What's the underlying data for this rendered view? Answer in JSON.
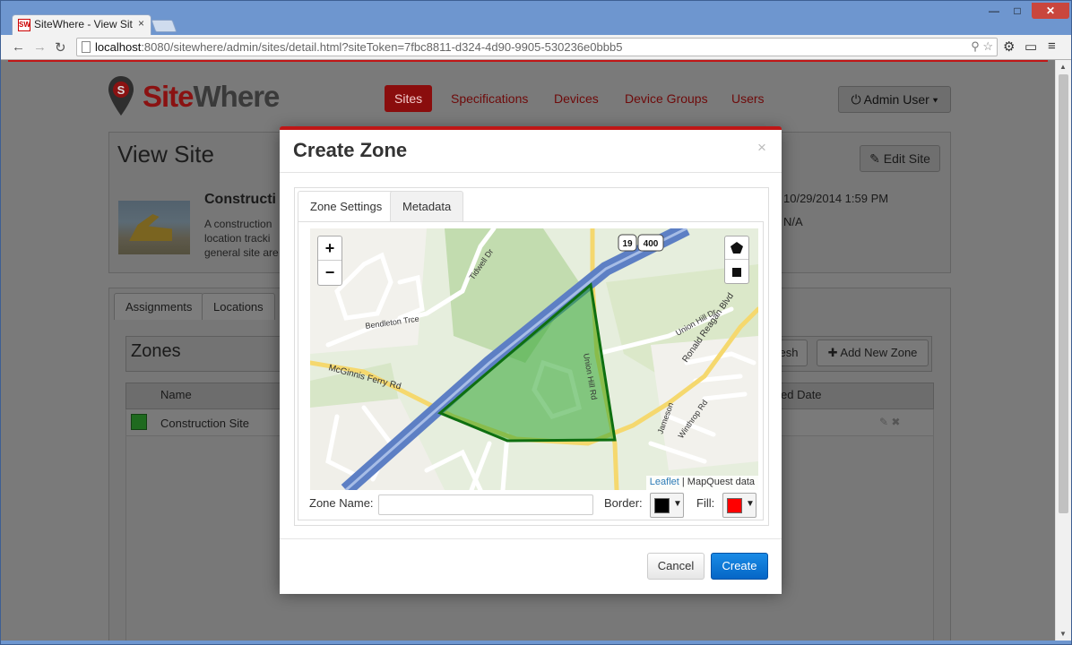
{
  "browser": {
    "tab_title": "SiteWhere - View Sit",
    "favicon_text": "SW",
    "tab_close": "×",
    "url_host": "localhost",
    "url_rest": ":8080/sitewhere/admin/sites/detail.html?siteToken=7fbc8811-d324-4d90-9905-530236e0bbb5",
    "icons": [
      "back-icon",
      "forward-icon",
      "reload-icon",
      "page-icon",
      "zoom-icon",
      "star-icon",
      "extension-icon",
      "cast-icon",
      "menu-icon",
      "minimize-icon",
      "maximize-icon",
      "close-icon"
    ]
  },
  "header": {
    "logo_site": "Site",
    "logo_where": "Where",
    "nav": [
      "Sites",
      "Specifications",
      "Devices",
      "Device Groups",
      "Users"
    ],
    "active_nav": "Sites",
    "user_button": "Admin User"
  },
  "site": {
    "page_title": "View Site",
    "edit_button": "Edit Site",
    "name": "Constructi",
    "desc_lines": [
      "A construction",
      "location tracki",
      "general site are"
    ],
    "created": "10/29/2014 1:59 PM",
    "updated": "N/A"
  },
  "bottom_tabs": [
    "Assignments",
    "Locations"
  ],
  "zones": {
    "title": "Zones",
    "refresh_label": "esh",
    "add_label": "Add New Zone",
    "columns": [
      "Name",
      "ed Date"
    ],
    "rows": [
      {
        "name": "Construction Site"
      }
    ]
  },
  "modal": {
    "title": "Create Zone",
    "close": "×",
    "tabs": [
      "Zone Settings",
      "Metadata"
    ],
    "active_tab": "Zone Settings",
    "zoom_in": "+",
    "zoom_out": "−",
    "attribution_link": "Leaflet",
    "attribution_rest": " | MapQuest data",
    "map_labels": [
      "Bendleton Trce",
      "McGinnis Ferry Rd",
      "Union Hill Dr",
      "Ronald Reagan Blvd",
      "Union Hill Rd",
      "Tidwell Dr",
      "Jameson",
      "Winthrop Rd"
    ],
    "highway_shields": [
      "19",
      "400"
    ],
    "zone_name_label": "Zone Name:",
    "zone_name_value": "",
    "border_label": "Border:",
    "fill_label": "Fill:",
    "border_color": "#000000",
    "fill_color": "#ff0000",
    "cancel": "Cancel",
    "create": "Create"
  },
  "colors": {
    "brand_red": "#c01616",
    "primary_blue": "#0566c6",
    "zone_green": "#2fa52f"
  }
}
